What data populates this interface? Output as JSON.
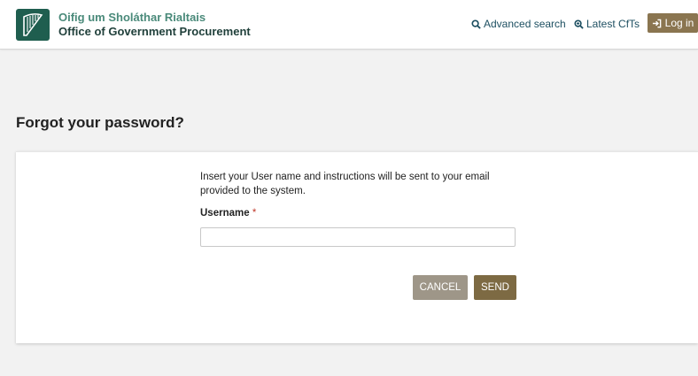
{
  "header": {
    "org_name_irish": "Oifig um Sholáthar Rialtais",
    "org_name_english": "Office of Government Procurement",
    "logo_icon": "harp-icon",
    "nav": {
      "advanced_search": "Advanced search",
      "latest_cfts": "Latest CfTs",
      "login": "Log in"
    }
  },
  "page": {
    "title": "Forgot your password?"
  },
  "form": {
    "instructions": "Insert your User name and instructions will be sent to your email provided to the system.",
    "username_label": "Username",
    "required_marker": "*",
    "username_value": "",
    "cancel_label": "CANCEL",
    "send_label": "SEND"
  },
  "colors": {
    "brand_green": "#1f5e4f",
    "nav_text": "#1d4f61",
    "login_button": "#8a7550",
    "send_button": "#7d6a43",
    "cancel_button": "#9e9688",
    "required": "#c0392b"
  }
}
